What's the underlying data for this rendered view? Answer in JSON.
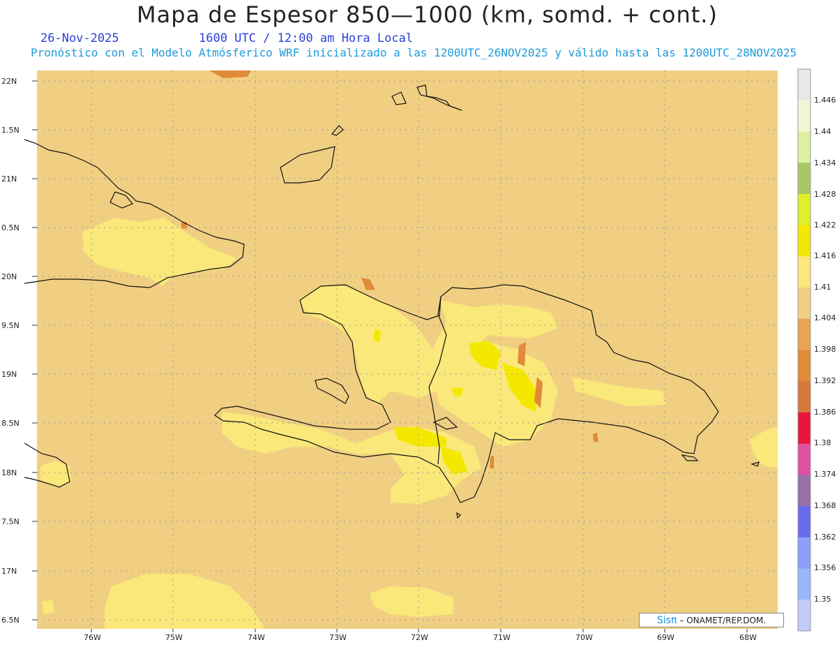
{
  "header": {
    "title": "Mapa de Espesor 850—1000 (km, somd. + cont.)",
    "date": "26-Nov-2025",
    "time": "1600 UTC / 12:00 am Hora Local",
    "subtitle": "Pronóstico con el Modelo Atmósferico WRF inicializado a las 1200UTC_26NOV2025 y válido hasta las  1200UTC_28NOV2025"
  },
  "axes": {
    "lat_labels": [
      "22N",
      "1.5N",
      "21N",
      "0.5N",
      "20N",
      "9.5N",
      "19N",
      "8.5N",
      "18N",
      "7.5N",
      "17N",
      "6.5N"
    ],
    "lon_labels": [
      "76W",
      "75W",
      "74W",
      "73W",
      "72W",
      "71W",
      "70W",
      "69W",
      "68W"
    ]
  },
  "colorbar": {
    "labels": [
      "1.446",
      "1.44",
      "1.434",
      "1.428",
      "1.422",
      "1.416",
      "1.41",
      "1.404",
      "1.398",
      "1.392",
      "1.386",
      "1.38",
      "1.374",
      "1.368",
      "1.362",
      "1.356",
      "1.35"
    ],
    "colors": [
      "#e8e8e8",
      "#f2f6d8",
      "#dcf0a0",
      "#a8c866",
      "#dff026",
      "#f4e800",
      "#fae87a",
      "#f0cf82",
      "#e8a450",
      "#e08a3a",
      "#d8763a",
      "#e8143c",
      "#e050a0",
      "#9870a8",
      "#6a6aee",
      "#8aa0fa",
      "#98b6fa",
      "#c0ccfa"
    ]
  },
  "credit": {
    "brand": "Sisπ",
    "text": "– ONAMET/REP.DOM."
  },
  "colors": {
    "background": "#f0cf82",
    "light": "#fae87a",
    "yellow": "#f4e800",
    "orange": "#e08a3a"
  }
}
